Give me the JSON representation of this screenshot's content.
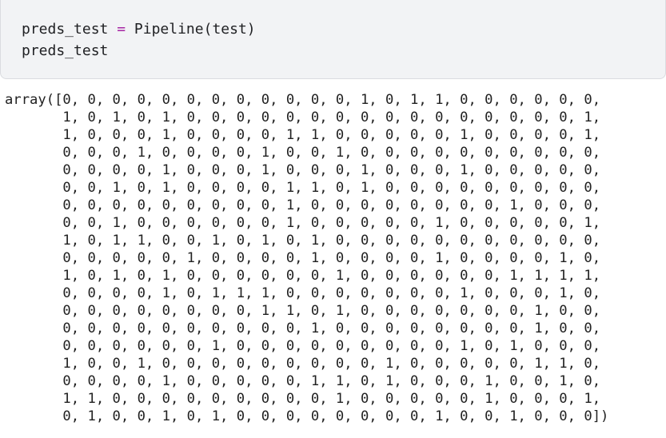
{
  "code_cell": {
    "line1": {
      "var": "preds_test",
      "op": "=",
      "expr": "Pipeline(test)"
    },
    "line2": "preds_test"
  },
  "output": {
    "lines": [
      "array([0, 0, 0, 0, 0, 0, 0, 0, 0, 0, 0, 0, 1, 0, 1, 1, 0, 0, 0, 0, 0, 0,",
      "       1, 0, 1, 0, 1, 0, 0, 0, 0, 0, 0, 0, 0, 0, 0, 0, 0, 0, 0, 0, 0, 1,",
      "       1, 0, 0, 0, 1, 0, 0, 0, 0, 1, 1, 0, 0, 0, 0, 0, 1, 0, 0, 0, 0, 1,",
      "       0, 0, 0, 1, 0, 0, 0, 0, 1, 0, 0, 1, 0, 0, 0, 0, 0, 0, 0, 0, 0, 0,",
      "       0, 0, 0, 0, 1, 0, 0, 0, 1, 0, 0, 0, 1, 0, 0, 0, 1, 0, 0, 0, 0, 0,",
      "       0, 0, 1, 0, 1, 0, 0, 0, 0, 1, 1, 0, 1, 0, 0, 0, 0, 0, 0, 0, 0, 0,",
      "       0, 0, 0, 0, 0, 0, 0, 0, 0, 1, 0, 0, 0, 0, 0, 0, 0, 0, 1, 0, 0, 0,",
      "       0, 0, 1, 0, 0, 0, 0, 0, 0, 1, 0, 0, 0, 0, 0, 1, 0, 0, 0, 0, 0, 1,",
      "       1, 0, 1, 1, 0, 0, 1, 0, 1, 0, 1, 0, 0, 0, 0, 0, 0, 0, 0, 0, 0, 0,",
      "       0, 0, 0, 0, 0, 1, 0, 0, 0, 0, 1, 0, 0, 0, 0, 1, 0, 0, 0, 0, 1, 0,",
      "       1, 0, 1, 0, 1, 0, 0, 0, 0, 0, 0, 1, 0, 0, 0, 0, 0, 0, 1, 1, 1, 1,",
      "       0, 0, 0, 0, 1, 0, 1, 1, 1, 0, 0, 0, 0, 0, 0, 0, 1, 0, 0, 0, 1, 0,",
      "       0, 0, 0, 0, 0, 0, 0, 0, 1, 1, 0, 1, 0, 0, 0, 0, 0, 0, 0, 1, 0, 0,",
      "       0, 0, 0, 0, 0, 0, 0, 0, 0, 0, 1, 0, 0, 0, 0, 0, 0, 0, 0, 1, 0, 0,",
      "       0, 0, 0, 0, 0, 0, 1, 0, 0, 0, 0, 0, 0, 0, 0, 0, 1, 0, 1, 0, 0, 0,",
      "       1, 0, 0, 1, 0, 0, 0, 0, 0, 0, 0, 0, 0, 1, 0, 0, 0, 0, 0, 1, 1, 0,",
      "       0, 0, 0, 0, 1, 0, 0, 0, 0, 0, 1, 1, 0, 1, 0, 0, 0, 1, 0, 0, 1, 0,",
      "       1, 1, 0, 0, 0, 0, 0, 0, 0, 0, 0, 1, 0, 0, 0, 0, 0, 1, 0, 0, 0, 1,",
      "       0, 1, 0, 0, 1, 0, 1, 0, 0, 0, 0, 0, 0, 0, 0, 1, 0, 0, 1, 0, 0, 0])"
    ]
  }
}
